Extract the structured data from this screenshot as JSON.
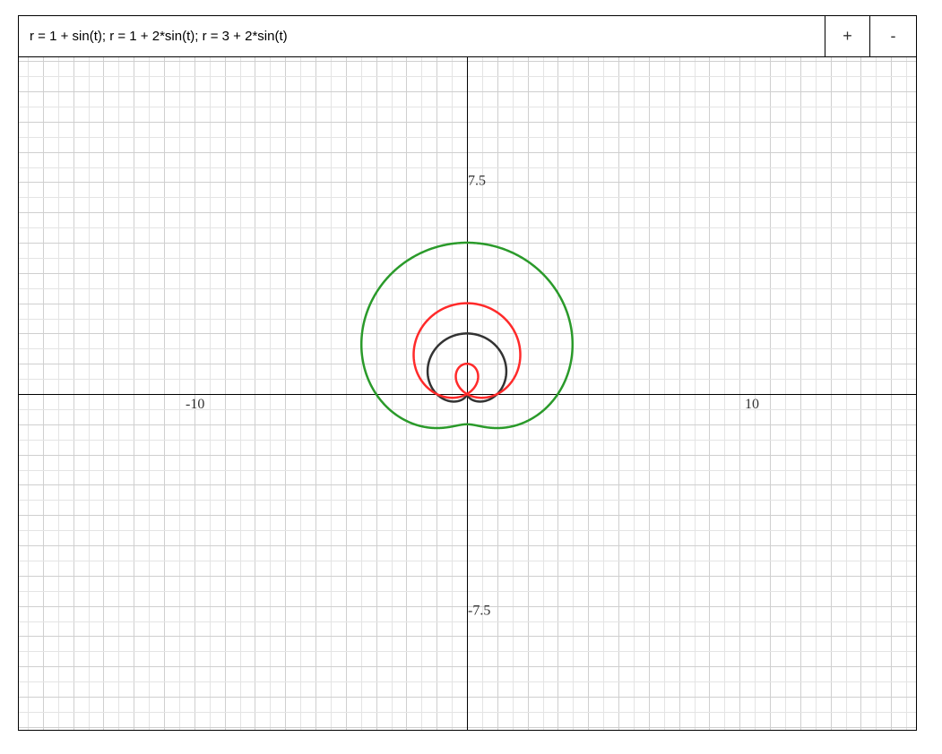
{
  "toolbar": {
    "expression": "r = 1 + sin(t); r = 1 + 2*sin(t); r = 3 + 2*sin(t)",
    "zoom_in_label": "+",
    "zoom_out_label": "-"
  },
  "chart_data": {
    "type": "line",
    "coordinate_system": "polar",
    "grid": true,
    "xlim": [
      -10,
      10
    ],
    "ylim": [
      -7.5,
      7.5
    ],
    "tick_labels": {
      "x_min": "-10",
      "x_max": "10",
      "y_max": "7.5",
      "y_min": "-7.5"
    },
    "series": [
      {
        "formula": "r = 1 + sin(t)",
        "a": 1,
        "b": 1,
        "color": "#333333"
      },
      {
        "formula": "r = 1 + 2*sin(t)",
        "a": 1,
        "b": 2,
        "color": "#ff2a2a"
      },
      {
        "formula": "r = 3 + 2*sin(t)",
        "a": 3,
        "b": 2,
        "color": "#2a9a2a"
      }
    ],
    "t_range": [
      0,
      6.283185307
    ]
  }
}
